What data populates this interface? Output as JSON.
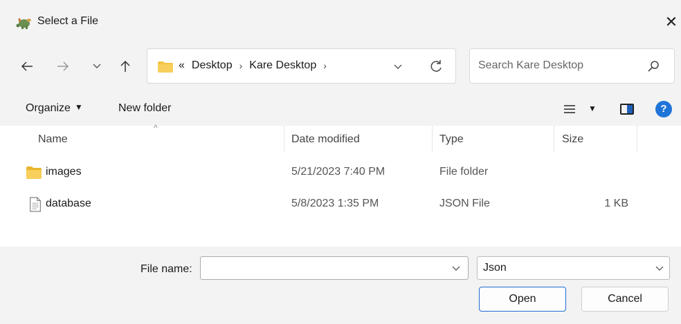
{
  "window": {
    "title": "Select a File",
    "app_icon": "turtle-icon",
    "close_icon": "close-icon"
  },
  "nav": {
    "back_icon": "arrow-left-icon",
    "forward_icon": "arrow-right-icon",
    "recent_icon": "chevron-down-icon",
    "up_icon": "arrow-up-icon",
    "breadcrumb": {
      "prefix": "«",
      "items": [
        "Desktop",
        "Kare Desktop"
      ],
      "separator": "›"
    },
    "refresh_icon": "refresh-icon",
    "search": {
      "placeholder": "Search Kare Desktop",
      "icon": "search-icon"
    }
  },
  "toolbar": {
    "organize_label": "Organize",
    "new_folder_label": "New folder",
    "view_icon": "list-view-icon",
    "preview_icon": "preview-pane-icon",
    "help_icon": "help-icon",
    "help_glyph": "?"
  },
  "file_list": {
    "columns": [
      {
        "label": "Name"
      },
      {
        "label": "Date modified"
      },
      {
        "label": "Type"
      },
      {
        "label": "Size"
      }
    ],
    "sort_indicator": "^",
    "rows": [
      {
        "name": "images",
        "icon": "folder-icon",
        "date": "5/21/2023 7:40 PM",
        "type": "File folder",
        "size": ""
      },
      {
        "name": "database",
        "icon": "document-icon",
        "date": "5/8/2023 1:35 PM",
        "type": "JSON File",
        "size": "1 KB"
      }
    ]
  },
  "footer": {
    "file_name_label": "File name:",
    "file_name_value": "",
    "file_type_value": "Json",
    "open_label": "Open",
    "cancel_label": "Cancel"
  },
  "colors": {
    "accent": "#1f6bd6",
    "chrome_bg": "#f3f3f3",
    "folder_yellow": "#f5c342"
  }
}
